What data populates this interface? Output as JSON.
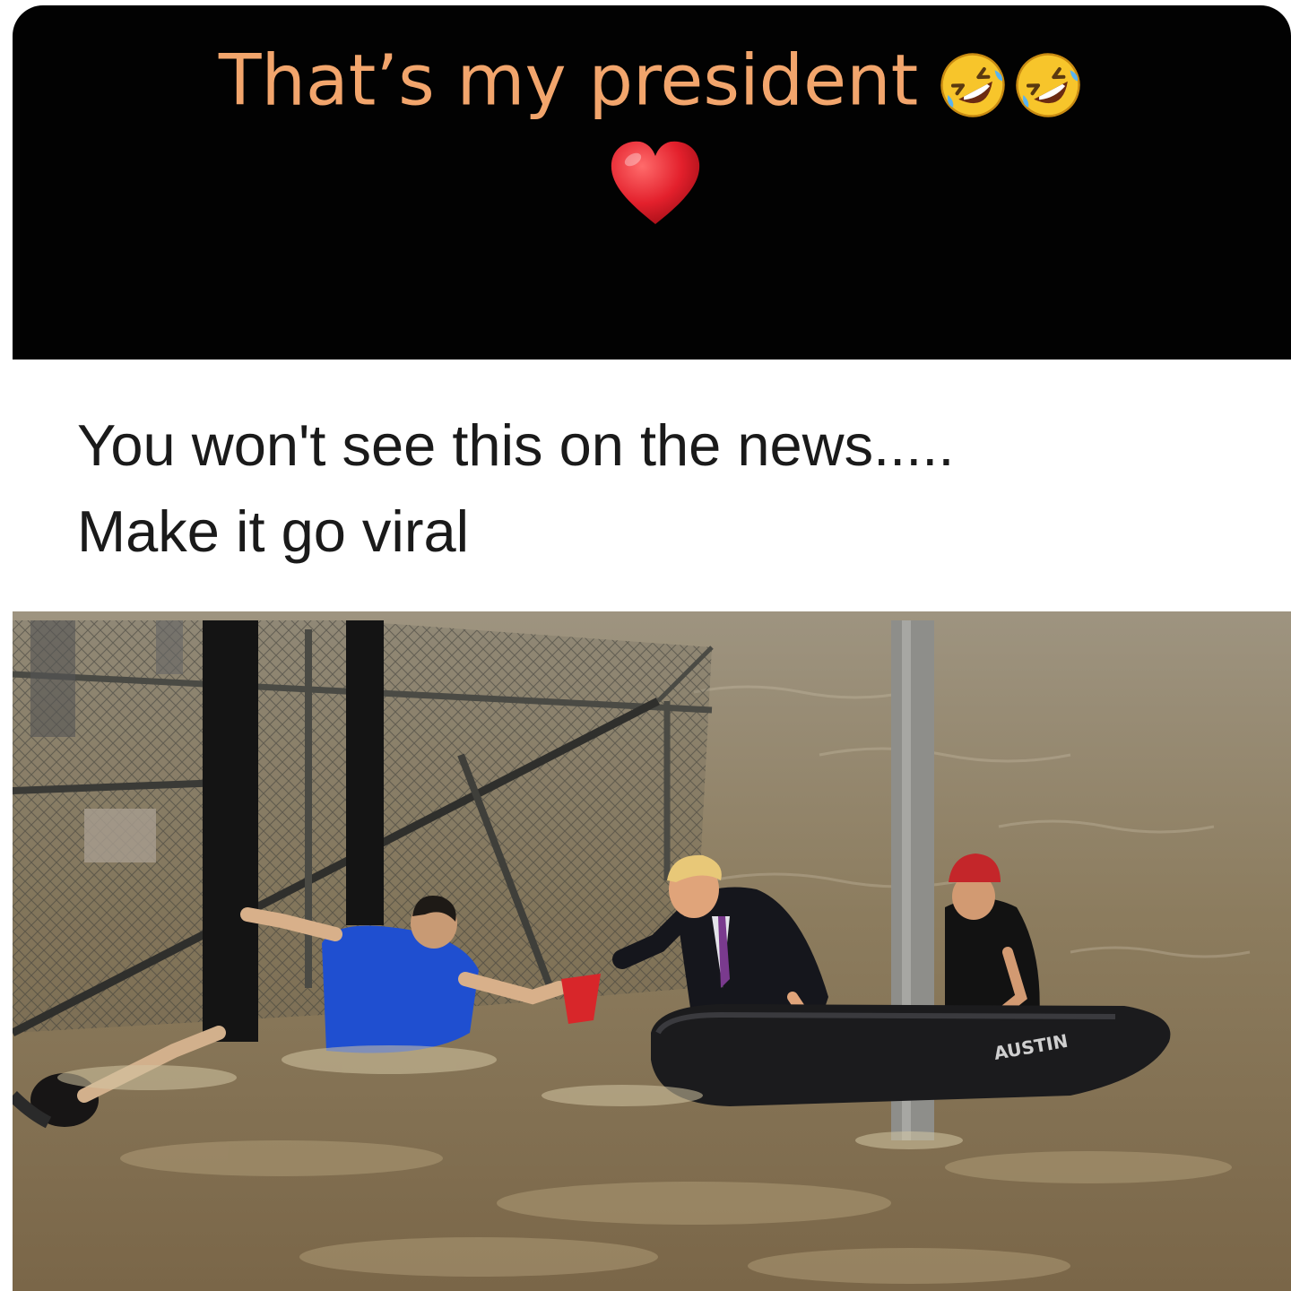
{
  "post": {
    "headline": "That’s my president",
    "headline_emojis": [
      "rolling-on-floor-laughing",
      "rolling-on-floor-laughing"
    ],
    "heart_emoji": "red-heart",
    "caption_line1": "You won't see this on the news.....",
    "caption_line2": "Make it go viral"
  },
  "photo": {
    "boat_label": "AUSTIN"
  },
  "colors": {
    "panel_background": "#020202",
    "headline_text": "#f2a56c",
    "caption_text": "#1a1a1a",
    "heart": "#e3202c",
    "floodwater": "#8a7a5e"
  }
}
